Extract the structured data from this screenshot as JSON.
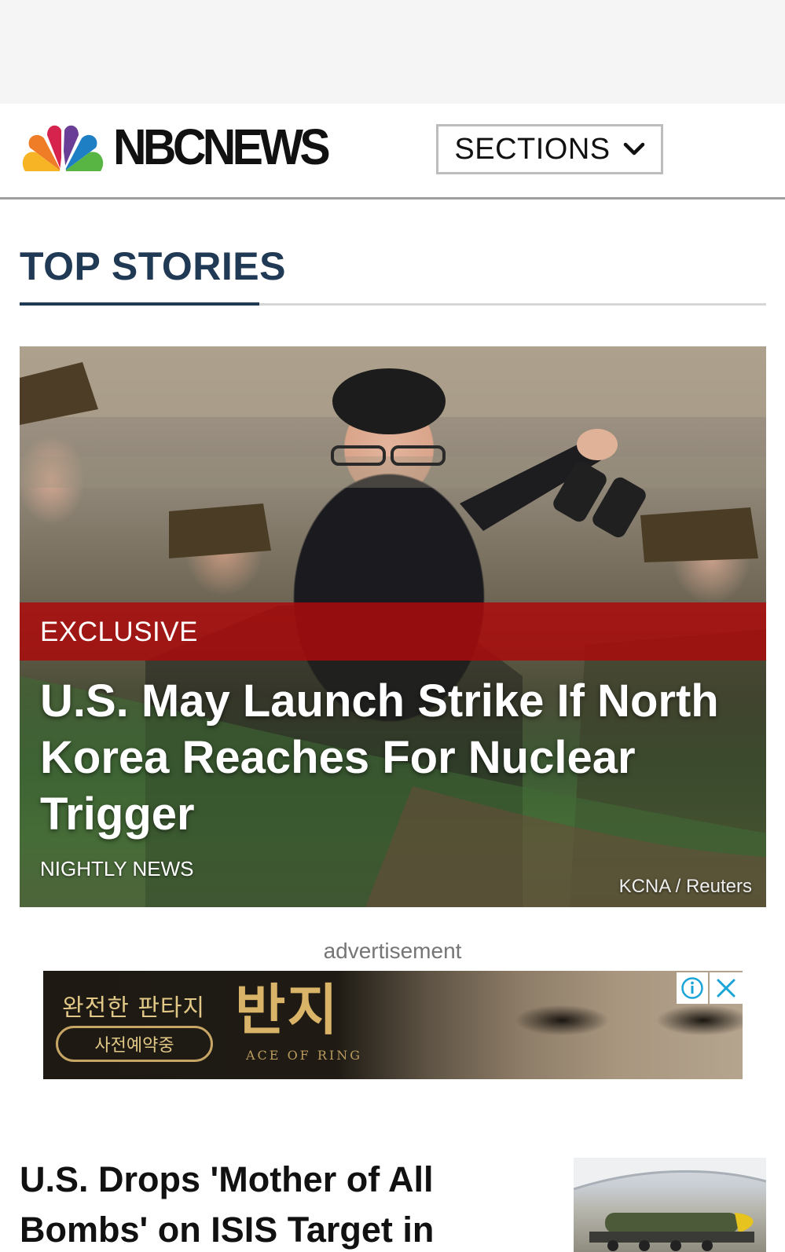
{
  "header": {
    "logo_text": "NBCNEWS",
    "sections_label": "SECTIONS"
  },
  "top_stories": {
    "title": "TOP STORIES"
  },
  "hero": {
    "badge": "EXCLUSIVE",
    "title": "U.S. May Launch Strike If North Korea Reaches For Nuclear Trigger",
    "show": "NIGHTLY NEWS",
    "credit": "KCNA / Reuters"
  },
  "ad": {
    "label": "advertisement",
    "line1": "완전한 판타지",
    "cta": "사전예약중",
    "title": "반지",
    "subtitle": "ACE OF RING"
  },
  "story": {
    "title": "U.S. Drops 'Mother of All Bombs' on ISIS Target in"
  },
  "colors": {
    "accent_navy": "#203a55",
    "badge_red": "#aa0a0c",
    "ad_close_blue": "#1aa4d8"
  }
}
